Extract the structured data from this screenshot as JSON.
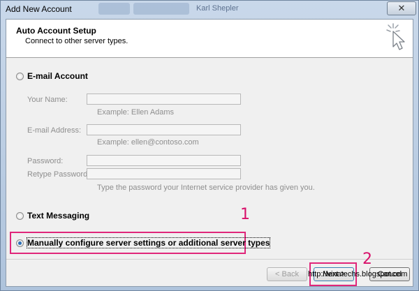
{
  "window": {
    "title": "Add New Account",
    "background_title": "Karl Shepler",
    "close_glyph": "✕"
  },
  "header": {
    "title": "Auto Account Setup",
    "subtitle": "Connect to other server types.",
    "icon": "wizard-cursor-icon"
  },
  "options": {
    "email_account": {
      "label": "E-mail Account",
      "selected": false
    },
    "text_messaging": {
      "label": "Text Messaging",
      "selected": false
    },
    "manual": {
      "label": "Manually configure server settings or additional server types",
      "selected": true
    }
  },
  "fields": {
    "your_name": {
      "label": "Your Name:",
      "value": "",
      "hint": "Example: Ellen Adams"
    },
    "email_address": {
      "label": "E-mail Address:",
      "value": "",
      "hint": "Example: ellen@contoso.com"
    },
    "password": {
      "label": "Password:",
      "value": ""
    },
    "retype_password": {
      "label": "Retype Password:",
      "value": ""
    },
    "password_hint": "Type the password your Internet service provider has given you."
  },
  "buttons": {
    "back": "< Back",
    "next": "Next >",
    "cancel": "Cancel"
  },
  "annotations": {
    "step1": "1",
    "step2": "2",
    "highlight_color": "#e0267a"
  },
  "watermark": "http://vinatechs.blogspot.com"
}
